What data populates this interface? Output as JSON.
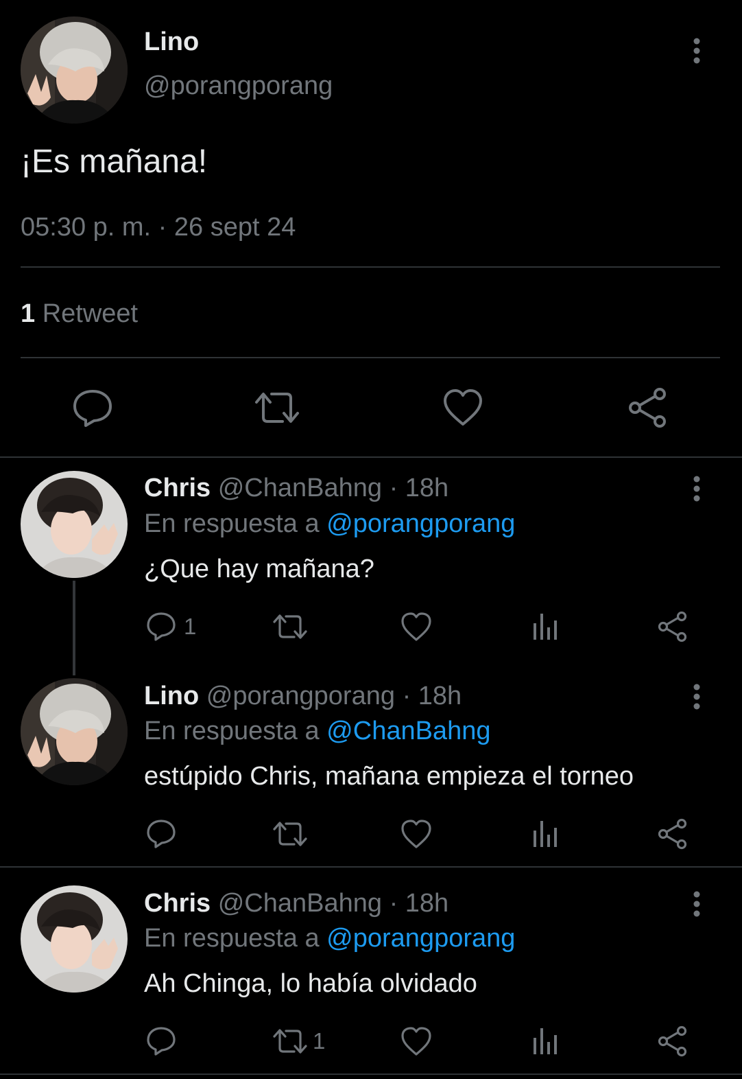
{
  "main_tweet": {
    "display_name": "Lino",
    "handle": "@porangporang",
    "text": "¡Es mañana!",
    "timestamp": "05:30 p. m. · 26 sept 24",
    "retweet_count": "1",
    "retweet_label": "Retweet"
  },
  "replies": [
    {
      "display_name": "Chris",
      "handle": "@ChanBahng",
      "time": "· 18h",
      "reply_prefix": "En respuesta a",
      "reply_to": "@porangporang",
      "text": "¿Que hay mañana?",
      "reply_count": "1",
      "retweet_count": ""
    },
    {
      "display_name": "Lino",
      "handle": "@porangporang",
      "time": "· 18h",
      "reply_prefix": "En respuesta a",
      "reply_to": "@ChanBahng",
      "text": "estúpido Chris, mañana empieza el torneo",
      "reply_count": "",
      "retweet_count": ""
    },
    {
      "display_name": "Chris",
      "handle": "@ChanBahng",
      "time": "· 18h",
      "reply_prefix": "En respuesta a",
      "reply_to": "@porangporang",
      "text": "Ah Chinga, lo había olvidado",
      "reply_count": "",
      "retweet_count": "1"
    }
  ],
  "colors": {
    "background": "#000000",
    "text": "#e7e9ea",
    "muted": "#71767b",
    "link": "#1d9bf0",
    "divider": "#2f3336"
  }
}
